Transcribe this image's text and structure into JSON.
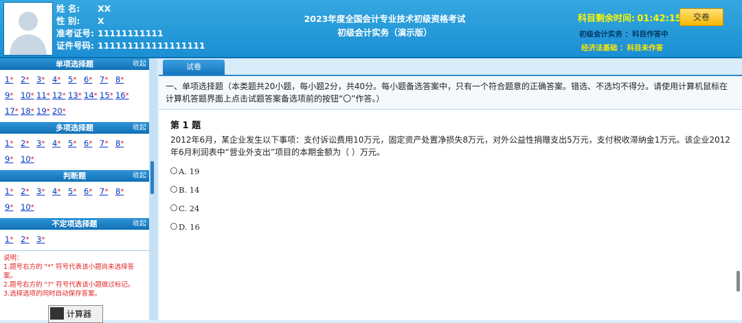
{
  "candidate": {
    "name_label": "姓    名:",
    "name": "XX",
    "gender_label": "性    别:",
    "gender": "X",
    "ticket_label": "准考证号:",
    "ticket": "11111111111",
    "id_label": "证件号码:",
    "id": "111111111111111111"
  },
  "exam": {
    "title_line1": "2023年度全国会计专业技术初级资格考试",
    "title_line2": "初级会计实务（演示版）"
  },
  "timer": {
    "label": "科目剩余时间:",
    "value": "01:42:15"
  },
  "submit_label": "交卷",
  "subjects": [
    {
      "text": "初级会计实务 ：科目作答中"
    },
    {
      "text": "经济法基础 ：科目未作答"
    }
  ],
  "sections": [
    {
      "title": "单项选择题",
      "collapse": "收起",
      "count": 20
    },
    {
      "title": "多项选择题",
      "collapse": "收起",
      "count": 10
    },
    {
      "title": "判断题",
      "collapse": "收起",
      "count": 10
    },
    {
      "title": "不定项选择题",
      "collapse": "收起",
      "count": 3
    }
  ],
  "unanswered_mark": "*",
  "notes": [
    "说明：",
    "1.题号右方的 \"*\" 符号代表该小题尚未选择答案。",
    "2.题号右方的 \"?\" 符号代表该小题做过标记。",
    "3.选择选项的同时自动保存答案。"
  ],
  "calculator_label": "计算器",
  "tab_label": "试卷",
  "instruction": "一、单项选择题（本类题共20小题，每小题2分，共40分。每小题备选答案中，只有一个符合题意的正确答案。错选、不选均不得分。请使用计算机鼠标在计算机答题界面上点击试题答案备选项前的按钮“〇”作答。）",
  "question": {
    "title": "第 1 题",
    "text": "2012年6月，某企业发生以下事项：支付诉讼费用10万元，固定资产处置净损失8万元，对外公益性捐赠支出5万元，支付税收滞纳金1万元。该企业2012年6月利润表中“营业外支出”项目的本期金额为（           ）万元。",
    "options": [
      {
        "label": "A.",
        "value": "19"
      },
      {
        "label": "B.",
        "value": "14"
      },
      {
        "label": "C.",
        "value": "24"
      },
      {
        "label": "D.",
        "value": "16"
      }
    ]
  }
}
